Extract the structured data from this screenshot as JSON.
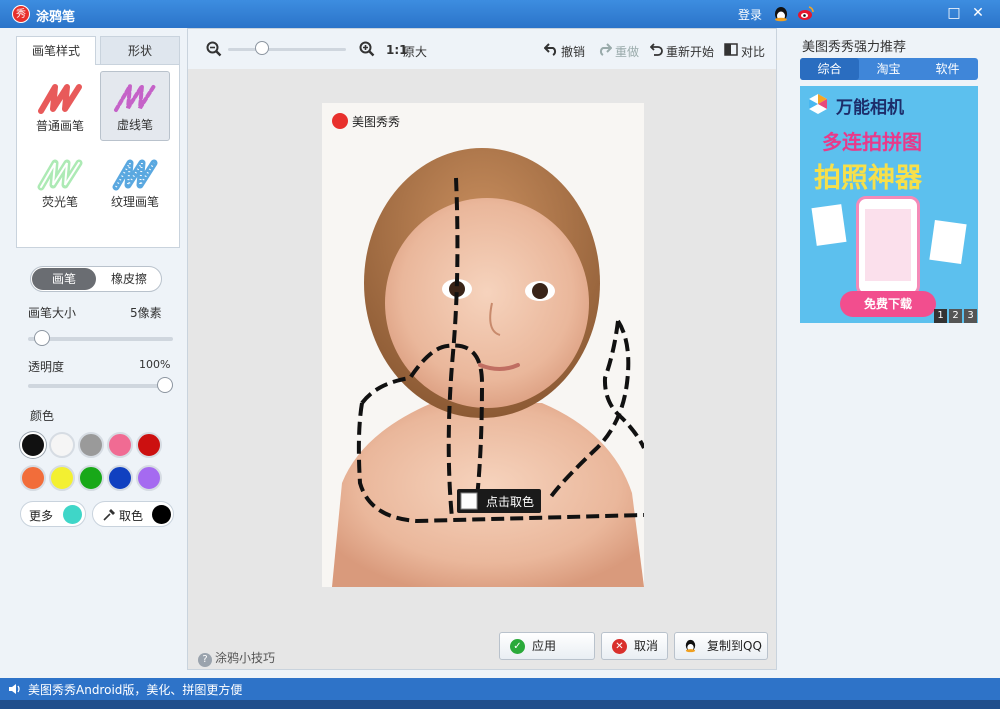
{
  "window": {
    "logo_char": "秀",
    "title": "涂鸦笔",
    "login": "登录",
    "minimize": "□",
    "close": "✕"
  },
  "brush_tabs": [
    {
      "label": "画笔样式"
    },
    {
      "label": "形状"
    }
  ],
  "brushes": [
    {
      "label": "普通画笔",
      "color": "#e85a5a"
    },
    {
      "label": "虚线笔",
      "color": "#c562c8"
    },
    {
      "label": "荧光笔",
      "color": "#9fe6a8"
    },
    {
      "label": "纹理画笔",
      "color": "#5aa8e0"
    }
  ],
  "mode": {
    "brush": "画笔",
    "eraser": "橡皮擦"
  },
  "size": {
    "label": "画笔大小",
    "value": "5像素",
    "level": 0.05
  },
  "opacity": {
    "label": "透明度",
    "value": "100%",
    "level": 1.0
  },
  "colors": {
    "label": "颜色",
    "swatches": [
      "#111111",
      "#f5f5f5",
      "#9a9a9a",
      "#f06b93",
      "#cc1010",
      "#f26d3a",
      "#f3f031",
      "#18a818",
      "#1040c0",
      "#a56af0"
    ],
    "more": "更多",
    "more_color": "#3fd6c8",
    "pick": "取色",
    "pick_color": "#000000"
  },
  "toolbar": {
    "zoom_out": "−",
    "zoom_in": "+",
    "ratio": "1:1",
    "original": "原大",
    "undo": "撤销",
    "redo": "重做",
    "restart": "重新开始",
    "compare": "对比"
  },
  "canvas": {
    "watermark": "美图秀秀",
    "tooltip": "点击取色"
  },
  "footer": {
    "tip": "涂鸦小技巧",
    "apply": "应用",
    "cancel": "取消",
    "copy_qq": "复制到QQ"
  },
  "recommend": {
    "title": "美图秀秀强力推荐",
    "tabs": [
      "综合",
      "淘宝",
      "软件"
    ],
    "ad_title": "万能相机",
    "ad_line1": "多连拍拼图",
    "ad_line2": "拍照神器",
    "ad_button": "免费下载",
    "pages": [
      "1",
      "2",
      "3"
    ]
  },
  "status": {
    "text": "美图秀秀Android版，美化、拼图更方便"
  }
}
